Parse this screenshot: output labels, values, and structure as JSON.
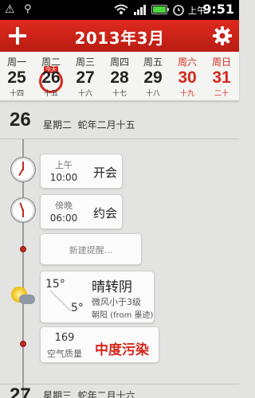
{
  "status_bar": {
    "icons": [
      "warning-icon",
      "usb-icon",
      "wifi-icon",
      "signal-icon",
      "battery-icon",
      "alarm-icon"
    ],
    "ampm": "上午",
    "time": "9:51"
  },
  "header": {
    "title": "2013年3月",
    "add_icon": "plus-icon",
    "settings_icon": "gear-icon",
    "accent": "#d5281d"
  },
  "week": {
    "days": [
      {
        "weekday": "周一",
        "date": "25",
        "lunar": "十四",
        "weekend": false,
        "today": false
      },
      {
        "weekday": "周二",
        "date": "26",
        "lunar": "十五",
        "weekend": false,
        "today": true,
        "today_tag": "今天"
      },
      {
        "weekday": "周三",
        "date": "27",
        "lunar": "十六",
        "weekend": false,
        "today": false
      },
      {
        "weekday": "周四",
        "date": "28",
        "lunar": "十七",
        "weekend": false,
        "today": false
      },
      {
        "weekday": "周五",
        "date": "29",
        "lunar": "十八",
        "weekend": false,
        "today": false
      },
      {
        "weekday": "周六",
        "date": "30",
        "lunar": "十九",
        "weekend": true,
        "today": false
      },
      {
        "weekday": "周日",
        "date": "31",
        "lunar": "二十",
        "weekend": true,
        "today": false
      }
    ]
  },
  "day1": {
    "date": "26",
    "weekday": "星期二",
    "lunar": "蛇年二月十五"
  },
  "events": [
    {
      "period": "上午",
      "time": "10:00",
      "title": "开会",
      "icon": "clock-icon"
    },
    {
      "period": "傍晚",
      "time": "06:00",
      "title": "约会",
      "icon": "clock-icon"
    }
  ],
  "new_reminder": {
    "placeholder": "新建提醒..."
  },
  "weather": {
    "icon": "partly-sunny-icon",
    "temp_high": "15°",
    "temp_low": "5°",
    "condition": "晴转阴",
    "wind": "微风小于3级",
    "source": "朝阳 (from 墨迹)"
  },
  "air": {
    "value": "169",
    "label": "空气质量",
    "level": "中度污染"
  },
  "day2": {
    "date": "27",
    "weekday": "星期三",
    "lunar": "蛇年二月十六"
  }
}
